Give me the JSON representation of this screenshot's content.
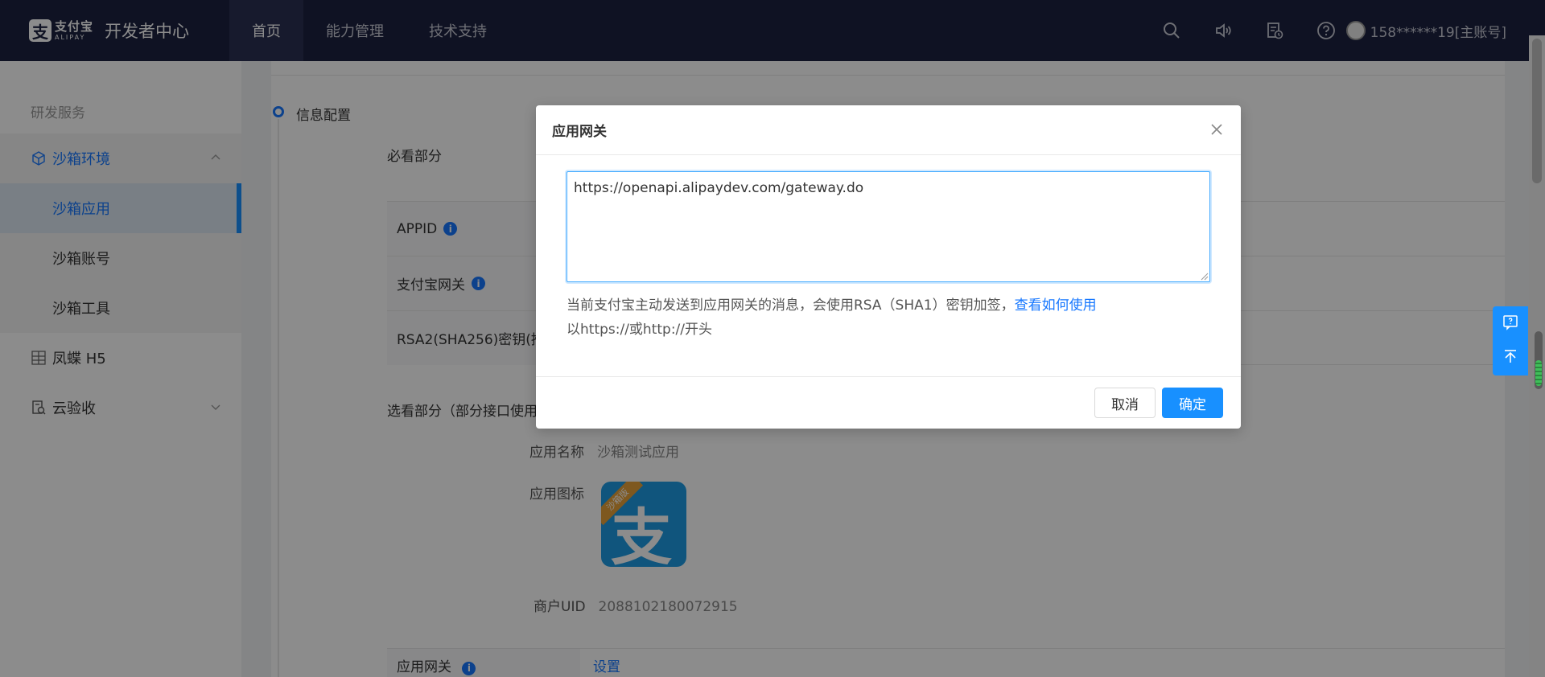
{
  "brand": {
    "mark": "支",
    "cn": "支付宝",
    "en": "ALIPAY",
    "title": "开发者中心"
  },
  "nav": [
    {
      "label": "首页",
      "active": true
    },
    {
      "label": "能力管理",
      "active": false
    },
    {
      "label": "技术支持",
      "active": false
    }
  ],
  "top_icons": [
    "search-icon",
    "speaker-icon",
    "document-clock-icon",
    "help-icon"
  ],
  "user": {
    "name": "158******19[主账号]"
  },
  "sidebar": {
    "section": "研发服务",
    "group": {
      "label": "沙箱环境",
      "expanded": true
    },
    "sub_items": [
      {
        "label": "沙箱应用",
        "active": true
      },
      {
        "label": "沙箱账号",
        "active": false
      },
      {
        "label": "沙箱工具",
        "active": false
      }
    ],
    "items": [
      {
        "label": "凤蝶 H5"
      },
      {
        "label": "云验收"
      }
    ]
  },
  "main": {
    "step_title": "信息配置",
    "required_title": "必看部分",
    "rows": [
      {
        "label": "APPID",
        "info": true
      },
      {
        "label": "支付宝网关",
        "info": true
      },
      {
        "label": "RSA2(SHA256)密钥(推"
      }
    ],
    "optional_title": "选看部分（部分接口使用",
    "app_name_label": "应用名称",
    "app_name_value": "沙箱测试应用",
    "app_icon_label": "应用图标",
    "app_icon_badge": "沙箱版",
    "app_icon_glyph": "支",
    "uid_label": "商户UID",
    "uid_value": "2088102180072915",
    "gateway_row_label": "应用网关",
    "gateway_row_link": "设置"
  },
  "modal": {
    "title": "应用网关",
    "input_value": "https://openapi.alipaydev.com/gateway.do",
    "hint_text": "当前支付宝主动发送到应用网关的消息，会使用RSA（SHA1）密钥加签，",
    "hint_link": "查看如何使用",
    "hint2": "以https://或http://开头",
    "cancel_label": "取消",
    "ok_label": "确定"
  },
  "colors": {
    "topbar": "#1d2240",
    "primary": "#1890ff",
    "link": "#1677ff"
  }
}
